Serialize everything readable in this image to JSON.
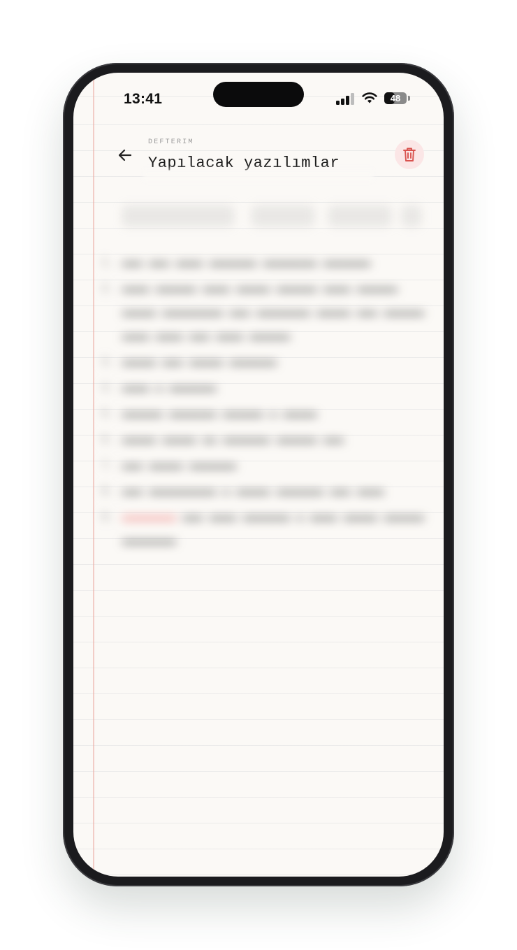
{
  "status_bar": {
    "time": "13:41",
    "battery_percent": "48",
    "battery_level": 0.48,
    "signal_bars_active": 3
  },
  "header": {
    "eyebrow": "DEFTERIM",
    "title": "Yapılacak yazılımlar",
    "back_icon": "arrow-left-icon",
    "delete_icon": "trash-icon"
  },
  "colors": {
    "background": "#fbf9f6",
    "margin_line": "#ebaaa0",
    "delete_accent": "#d9534f",
    "delete_bg": "#fbe6e6"
  }
}
